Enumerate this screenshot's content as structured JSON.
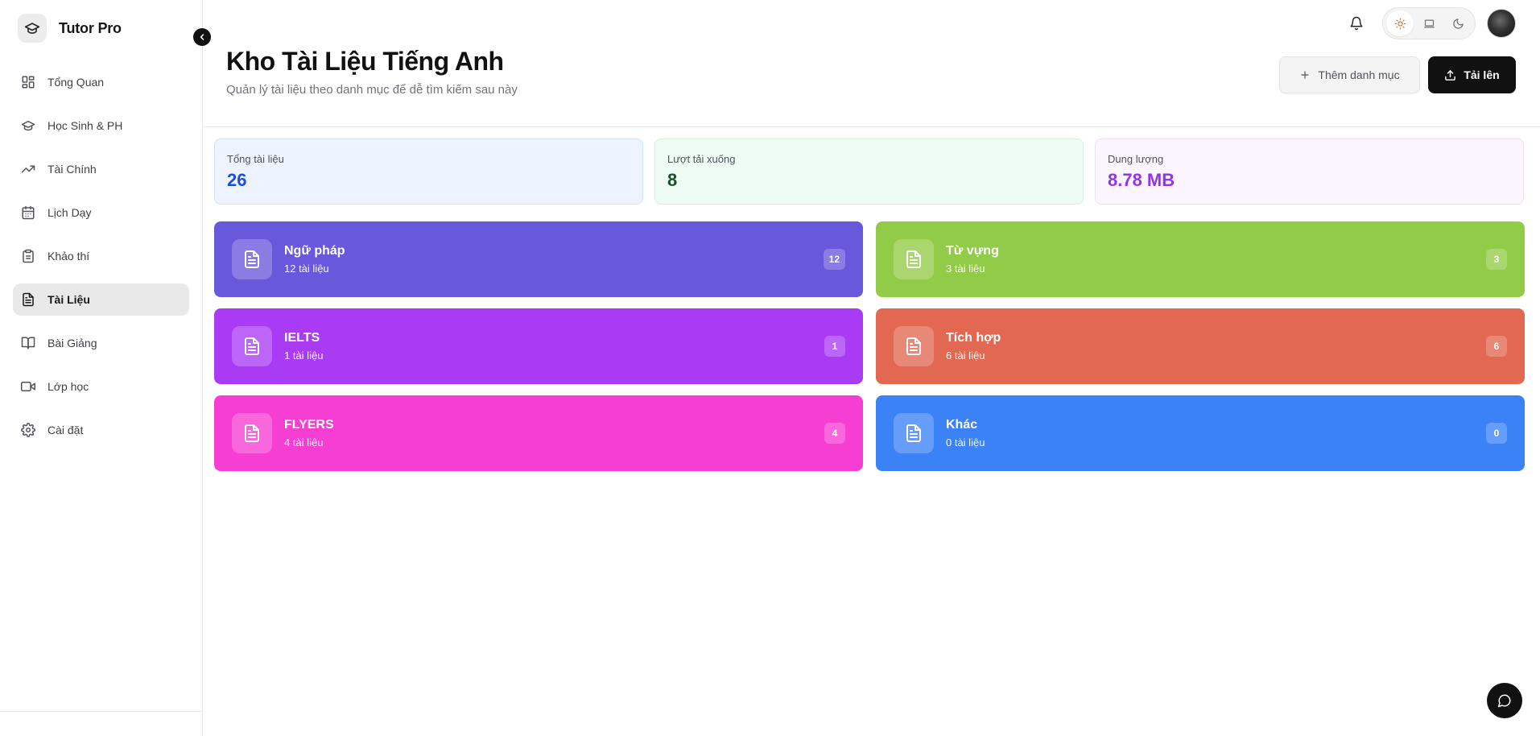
{
  "app": {
    "name": "Tutor Pro"
  },
  "sidebar": {
    "items": [
      {
        "label": "Tổng Quan",
        "icon": "dashboard-icon",
        "active": false
      },
      {
        "label": "Học Sinh & PH",
        "icon": "graduation-cap-icon",
        "active": false
      },
      {
        "label": "Tài Chính",
        "icon": "trending-up-icon",
        "active": false
      },
      {
        "label": "Lịch Dạy",
        "icon": "calendar-icon",
        "active": false
      },
      {
        "label": "Khảo thí",
        "icon": "clipboard-icon",
        "active": false
      },
      {
        "label": "Tài Liệu",
        "icon": "file-text-icon",
        "active": true
      },
      {
        "label": "Bài Giảng",
        "icon": "book-open-icon",
        "active": false
      },
      {
        "label": "Lớp học",
        "icon": "video-icon",
        "active": false
      },
      {
        "label": "Cài đặt",
        "icon": "settings-icon",
        "active": false
      }
    ]
  },
  "topbar": {
    "theme_options": [
      "sun-icon",
      "laptop-icon",
      "moon-icon"
    ],
    "active_theme": "sun-icon"
  },
  "header": {
    "title": "Kho Tài Liệu Tiếng Anh",
    "subtitle": "Quản lý tài liệu theo danh mục để dễ tìm kiếm sau này",
    "add_category_label": "Thêm danh mục",
    "upload_label": "Tải lên"
  },
  "stats": [
    {
      "label": "Tổng tài liệu",
      "value": "26"
    },
    {
      "label": "Lượt tải xuống",
      "value": "8"
    },
    {
      "label": "Dung lượng",
      "value": "8.78 MB"
    }
  ],
  "categories": [
    {
      "name": "Ngữ pháp",
      "count_text": "12 tài liệu",
      "badge": "12",
      "color": "#6858dc"
    },
    {
      "name": "Từ vựng",
      "count_text": "3 tài liệu",
      "badge": "3",
      "color": "#92cb47"
    },
    {
      "name": "IELTS",
      "count_text": "1 tài liệu",
      "badge": "1",
      "color": "#a93bf5"
    },
    {
      "name": "Tích hợp",
      "count_text": "6 tài liệu",
      "badge": "6",
      "color": "#e26852"
    },
    {
      "name": "FLYERS",
      "count_text": "4 tài liệu",
      "badge": "4",
      "color": "#f73ed3"
    },
    {
      "name": "Khác",
      "count_text": "0 tài liệu",
      "badge": "0",
      "color": "#3b82f6"
    }
  ]
}
